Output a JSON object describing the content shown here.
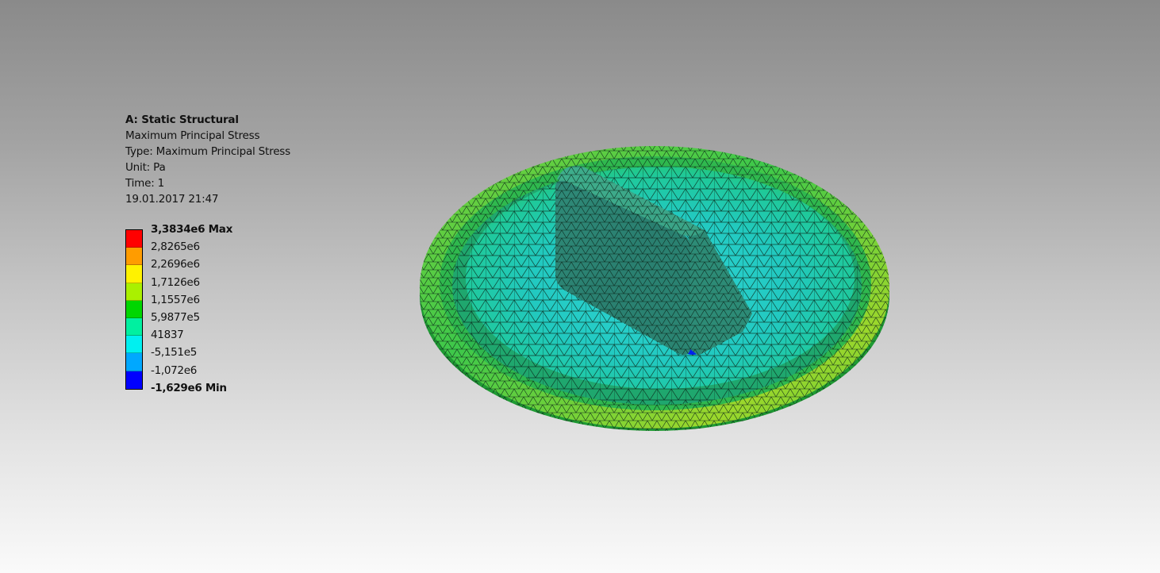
{
  "info": {
    "analysis": "A: Static Structural",
    "result": "Maximum Principal Stress",
    "type": "Type: Maximum Principal Stress",
    "unit": "Unit: Pa",
    "time": "Time: 1",
    "datetime": "19.01.2017 21:47"
  },
  "legend": {
    "max_label": "3,3834e6 Max",
    "min_label": "-1,629e6 Min",
    "values": [
      "3,3834e6 Max",
      "2,8265e6",
      "2,2696e6",
      "1,7126e6",
      "1,1557e6",
      "5,9877e5",
      "41837",
      "-5,151e5",
      "-1,072e6",
      "-1,629e6 Min"
    ],
    "colors": [
      "#ff0000",
      "#ff9c00",
      "#fff200",
      "#aaf000",
      "#00d600",
      "#00f0a0",
      "#00f0f0",
      "#00a8ff",
      "#0000ff"
    ]
  }
}
